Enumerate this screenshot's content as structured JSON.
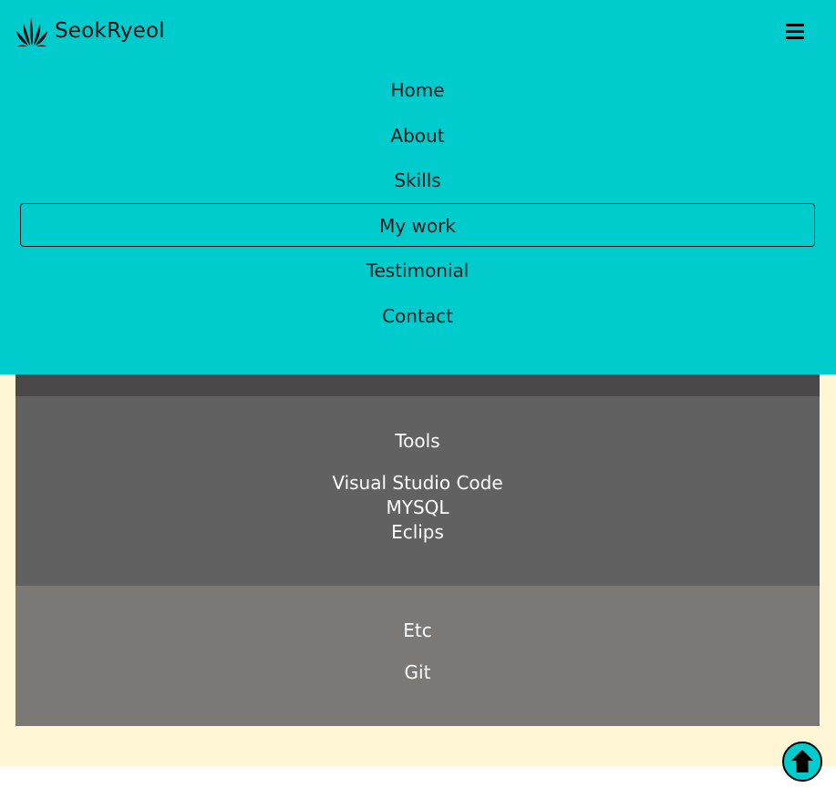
{
  "brand": {
    "name": "SeokRyeol"
  },
  "nav": {
    "items": [
      {
        "label": "Home"
      },
      {
        "label": "About"
      },
      {
        "label": "Skills"
      },
      {
        "label": "My work",
        "active": true
      },
      {
        "label": "Testimonial"
      },
      {
        "label": "Contact"
      }
    ]
  },
  "skills": {
    "tools": {
      "title": "Tools",
      "items": [
        "Visual Studio Code",
        "MYSQL",
        "Eclips"
      ]
    },
    "etc": {
      "title": "Etc",
      "items": [
        "Git"
      ]
    }
  },
  "icons": {
    "logo": "plant-logo-icon",
    "menu": "hamburger-menu-icon",
    "scroll_top": "arrow-up-circle-icon"
  },
  "colors": {
    "navbar": "#00cccd",
    "section_bg": "#fff6d5",
    "tools_bg": "#616161",
    "etc_bg": "#7b7876",
    "accent": "#00cccd"
  }
}
